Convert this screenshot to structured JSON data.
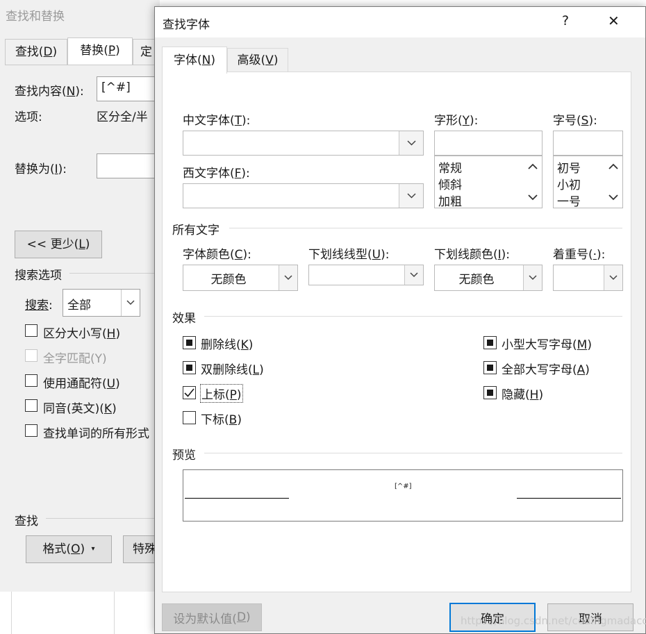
{
  "bg": {
    "title": "查找和替换",
    "tabs": [
      {
        "text": "查找(",
        "key": "D",
        "close": ")"
      },
      {
        "text": "替换(",
        "key": "P",
        "close": ")"
      },
      {
        "text": "定"
      }
    ],
    "find_label": {
      "text": "查找内容(",
      "key": "N",
      "close": "):"
    },
    "find_value": "[^#]",
    "options_label": "选项:",
    "options_value": "区分全/半",
    "replace_label": {
      "text": "替换为(",
      "key": "I",
      "close": "):"
    },
    "less_button": {
      "text": "<< 更少(",
      "key": "L",
      "close": ")"
    },
    "search_options_title": "搜索选项",
    "search_label": {
      "text": "搜索",
      "key": "",
      "close": ":"
    },
    "search_value": "全部",
    "checkboxes": [
      {
        "text": "区分大小写(",
        "key": "H",
        "close": ")",
        "disabled": false
      },
      {
        "text": "全字匹配(Y)",
        "key": "",
        "close": "",
        "disabled": true
      },
      {
        "text": "使用通配符(",
        "key": "U",
        "close": ")",
        "disabled": false
      },
      {
        "text": "同音(英文)(",
        "key": "K",
        "close": ")",
        "disabled": false
      },
      {
        "text": "查找单词的所有形式",
        "key": "",
        "close": "",
        "disabled": false
      }
    ],
    "find_section_title": "查找",
    "format_button": {
      "text": "格式(",
      "key": "O",
      "close": ")"
    },
    "special_button": "特殊"
  },
  "dialog": {
    "title": "查找字体",
    "help_glyph": "?",
    "close_glyph": "✕",
    "tabs": [
      {
        "text": "字体(",
        "key": "N",
        "close": ")"
      },
      {
        "text": "高级(",
        "key": "V",
        "close": ")"
      }
    ],
    "chinese_font_label": {
      "text": "中文字体(",
      "key": "T",
      "close": "):"
    },
    "western_font_label": {
      "text": "西文字体(",
      "key": "F",
      "close": "):"
    },
    "style_label": {
      "text": "字形(",
      "key": "Y",
      "close": "):"
    },
    "style_items": [
      "常规",
      "倾斜",
      "加粗"
    ],
    "size_label": {
      "text": "字号(",
      "key": "S",
      "close": "):"
    },
    "size_items": [
      "初号",
      "小初",
      "一号"
    ],
    "all_text_title": "所有文字",
    "font_color_label": {
      "text": "字体颜色(",
      "key": "C",
      "close": "):"
    },
    "font_color_value": "无颜色",
    "underline_style_label": {
      "text": "下划线线型(",
      "key": "U",
      "close": "):"
    },
    "underline_color_label": {
      "text": "下划线颜色(",
      "key": "I",
      "close": "):"
    },
    "underline_color_value": "无颜色",
    "emphasis_label": {
      "text": "着重号(",
      "key": "·",
      "close": "):"
    },
    "effects_title": "效果",
    "effects_left": [
      {
        "text": "删除线(",
        "key": "K",
        "close": ")",
        "state": "indeterminate"
      },
      {
        "text": "双删除线(",
        "key": "L",
        "close": ")",
        "state": "indeterminate"
      },
      {
        "text": "上标(",
        "key": "P",
        "close": ")",
        "state": "checked"
      },
      {
        "text": "下标(",
        "key": "B",
        "close": ")",
        "state": "unchecked"
      }
    ],
    "effects_right": [
      {
        "text": "小型大写字母(",
        "key": "M",
        "close": ")",
        "state": "indeterminate"
      },
      {
        "text": "全部大写字母(",
        "key": "A",
        "close": ")",
        "state": "indeterminate"
      },
      {
        "text": "隐藏(",
        "key": "H",
        "close": ")",
        "state": "indeterminate"
      }
    ],
    "preview_title": "预览",
    "preview_text": "[^#]",
    "default_button": {
      "text": "设为默认值(",
      "key": "D",
      "close": ")"
    },
    "ok_button": "确定",
    "cancel_button": "取消",
    "watermark": "https://blog.csdn.net/codingmadacode"
  }
}
